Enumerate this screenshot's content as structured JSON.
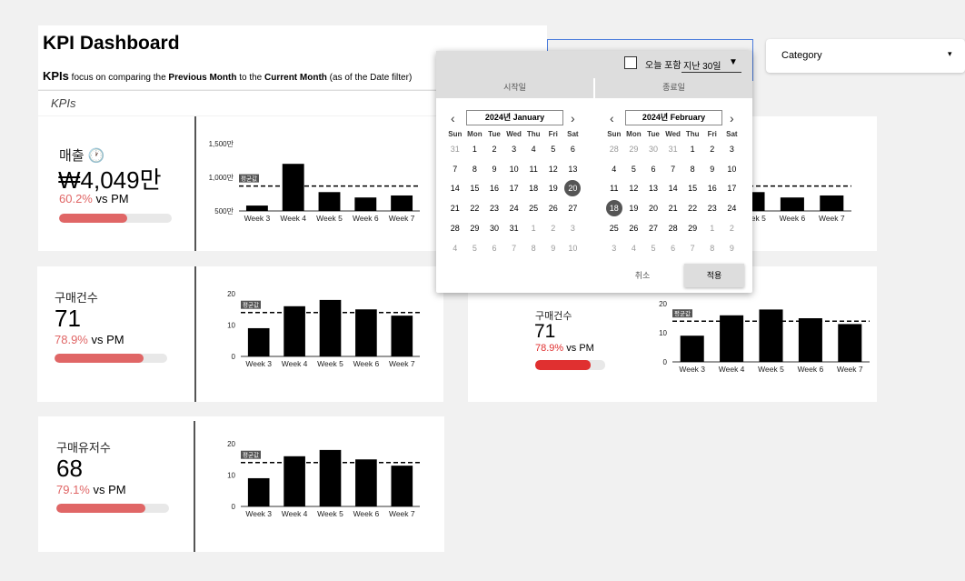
{
  "header": {
    "title": "KPI Dashboard",
    "subtitle_kpis": "KPIs",
    "subtitle_1": " focus on comparing the ",
    "subtitle_prev": "Previous Month",
    "subtitle_2": " to the ",
    "subtitle_curr": "Current Month",
    "subtitle_3": " (as of the Date filter)"
  },
  "section_label": "KPIs",
  "category": {
    "label": "Category"
  },
  "avg_label": "평균값",
  "weeks": [
    "Week 3",
    "Week 4",
    "Week 5",
    "Week 6",
    "Week 7"
  ],
  "kpis": [
    {
      "label": "매출",
      "value": "₩4,049만",
      "pct": "60.2%",
      "vs": " vs PM",
      "progress": 0.602,
      "yticks": [
        "1,500만",
        "1,000만",
        "500만"
      ]
    },
    {
      "label": "구매건수",
      "value": "71",
      "pct": "78.9%",
      "vs": " vs PM",
      "progress": 0.789,
      "yticks": [
        "20",
        "10",
        "0"
      ]
    },
    {
      "label": "구매건수",
      "value": "71",
      "pct": "78.9%",
      "vs": " vs PM",
      "progress": 0.789,
      "yticks": [
        "20",
        "10",
        "0"
      ]
    },
    {
      "label": "구매유저수",
      "value": "68",
      "pct": "79.1%",
      "vs": " vs PM",
      "progress": 0.791,
      "yticks": [
        "20",
        "10",
        "0"
      ]
    }
  ],
  "chart_data": [
    {
      "type": "bar",
      "categories": [
        "Week 3",
        "Week 4",
        "Week 5",
        "Week 6",
        "Week 7"
      ],
      "values": [
        580,
        1200,
        780,
        700,
        730
      ],
      "ylim": [
        500,
        1500
      ],
      "average": 870
    },
    {
      "type": "bar",
      "categories": [
        "Week 3",
        "Week 4",
        "Week 5",
        "Week 6",
        "Week 7"
      ],
      "values": [
        9,
        16,
        18,
        15,
        13
      ],
      "ylim": [
        0,
        20
      ],
      "average": 14
    },
    {
      "type": "bar",
      "categories": [
        "Week 3",
        "Week 4",
        "Week 5",
        "Week 6",
        "Week 7"
      ],
      "values": [
        9,
        16,
        18,
        15,
        13
      ],
      "ylim": [
        0,
        20
      ],
      "average": 14
    },
    {
      "type": "bar",
      "categories": [
        "Week 3",
        "Week 4",
        "Week 5",
        "Week 6",
        "Week 7"
      ],
      "values": [
        9,
        16,
        18,
        15,
        13
      ],
      "ylim": [
        0,
        20
      ],
      "average": 14
    }
  ],
  "datepicker": {
    "include_today": "오늘 포함",
    "range": "지난 30일",
    "start_tab": "시작일",
    "end_tab": "종료일",
    "left_month": "2024년 January",
    "right_month": "2024년 February",
    "dow": [
      "Sun",
      "Mon",
      "Tue",
      "Wed",
      "Thu",
      "Fri",
      "Sat"
    ],
    "left_days": [
      [
        "31",
        "1",
        "2",
        "3",
        "4",
        "5",
        "6"
      ],
      [
        "7",
        "8",
        "9",
        "10",
        "11",
        "12",
        "13"
      ],
      [
        "14",
        "15",
        "16",
        "17",
        "18",
        "19",
        "20"
      ],
      [
        "21",
        "22",
        "23",
        "24",
        "25",
        "26",
        "27"
      ],
      [
        "28",
        "29",
        "30",
        "31",
        "1",
        "2",
        "3"
      ],
      [
        "4",
        "5",
        "6",
        "7",
        "8",
        "9",
        "10"
      ]
    ],
    "right_days": [
      [
        "28",
        "29",
        "30",
        "31",
        "1",
        "2",
        "3"
      ],
      [
        "4",
        "5",
        "6",
        "7",
        "8",
        "9",
        "10"
      ],
      [
        "11",
        "12",
        "13",
        "14",
        "15",
        "16",
        "17"
      ],
      [
        "18",
        "19",
        "20",
        "21",
        "22",
        "23",
        "24"
      ],
      [
        "25",
        "26",
        "27",
        "28",
        "29",
        "1",
        "2"
      ],
      [
        "3",
        "4",
        "5",
        "6",
        "7",
        "8",
        "9"
      ]
    ],
    "cancel": "취소",
    "apply": "적용"
  }
}
